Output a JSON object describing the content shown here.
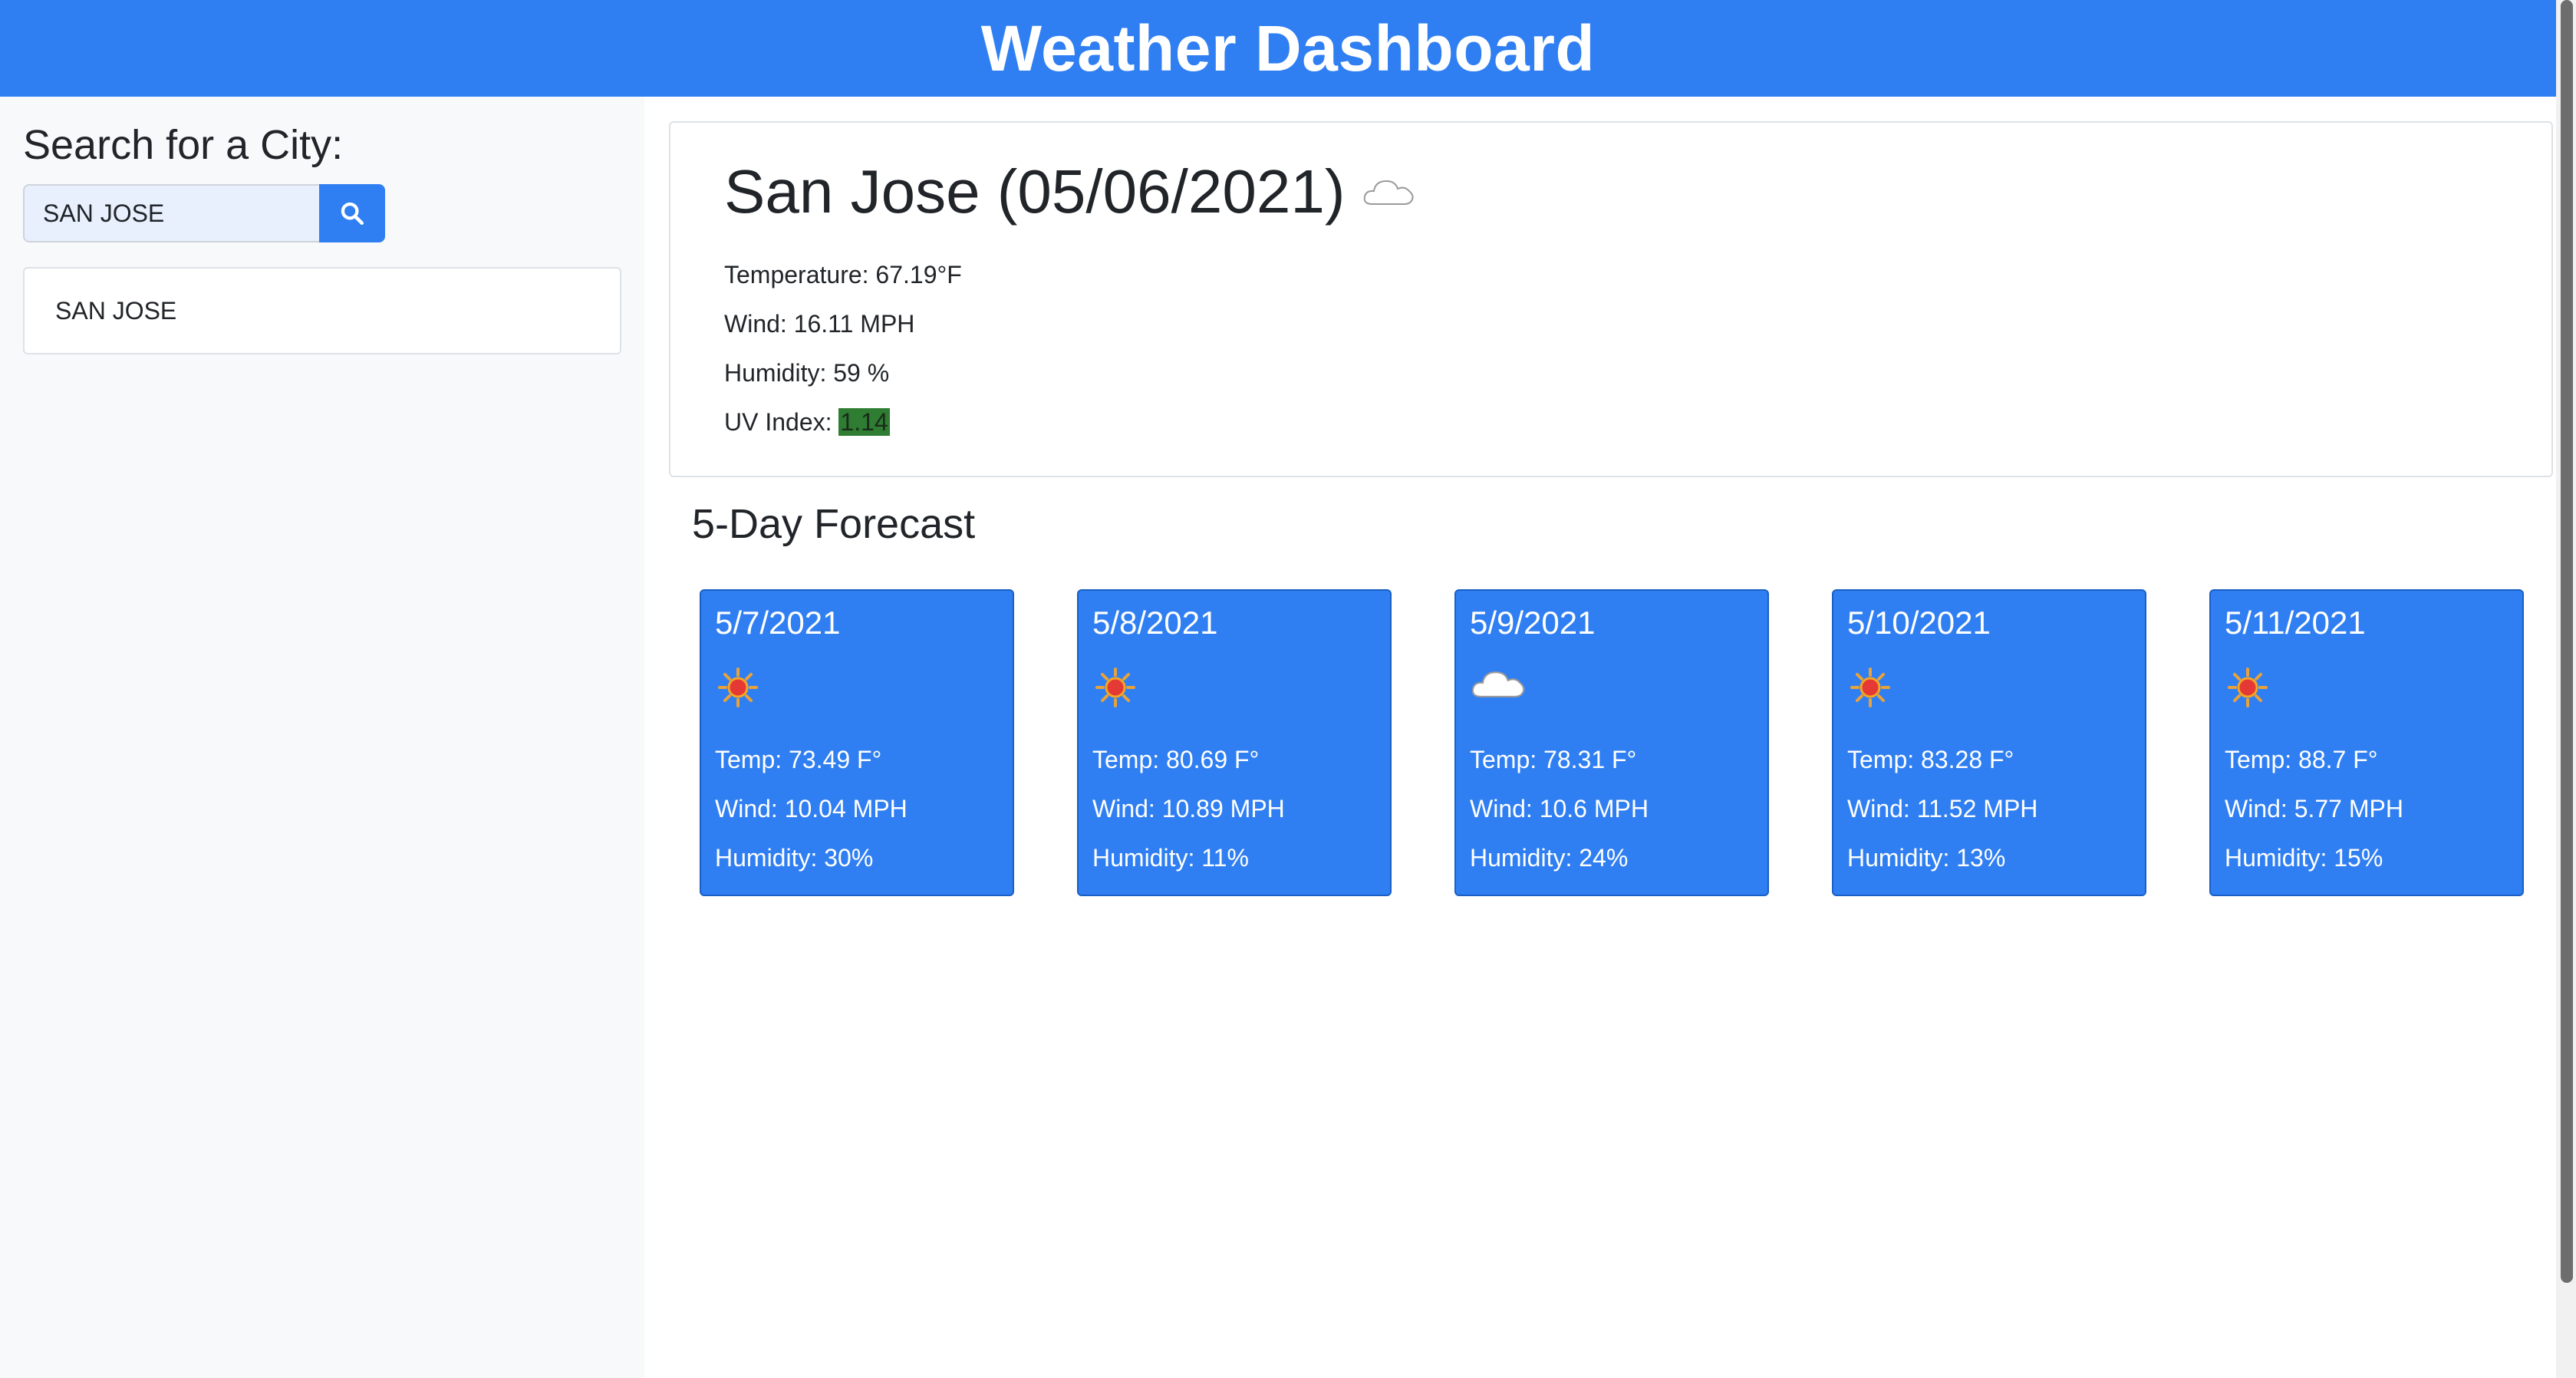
{
  "header": {
    "title": "Weather Dashboard"
  },
  "sidebar": {
    "search_label": "Search for a City:",
    "search_value": "SAN JOSE",
    "history": [
      "SAN JOSE"
    ]
  },
  "current": {
    "title": "San Jose (05/06/2021)",
    "icon": "cloud-icon",
    "temperature": "Temperature: 67.19°F",
    "wind": "Wind: 16.11 MPH",
    "humidity": "Humidity: 59 %",
    "uv_label": "UV Index: ",
    "uv_value": "1.14",
    "uv_color": "#2e7d32"
  },
  "forecast": {
    "title": "5-Day Forecast",
    "days": [
      {
        "date": "5/7/2021",
        "icon": "sun-icon",
        "temp": "Temp: 73.49 F°",
        "wind": "Wind: 10.04 MPH",
        "humidity": "Humidity: 30%"
      },
      {
        "date": "5/8/2021",
        "icon": "sun-icon",
        "temp": "Temp: 80.69 F°",
        "wind": "Wind: 10.89 MPH",
        "humidity": "Humidity: 11%"
      },
      {
        "date": "5/9/2021",
        "icon": "cloud-icon",
        "temp": "Temp: 78.31 F°",
        "wind": "Wind: 10.6 MPH",
        "humidity": "Humidity: 24%"
      },
      {
        "date": "5/10/2021",
        "icon": "sun-icon",
        "temp": "Temp: 83.28 F°",
        "wind": "Wind: 11.52 MPH",
        "humidity": "Humidity: 13%"
      },
      {
        "date": "5/11/2021",
        "icon": "sun-icon",
        "temp": "Temp: 88.7 F°",
        "wind": "Wind: 5.77 MPH",
        "humidity": "Humidity: 15%"
      }
    ]
  },
  "colors": {
    "accent": "#307ff2",
    "sidebar_bg": "#f8f9fa"
  }
}
